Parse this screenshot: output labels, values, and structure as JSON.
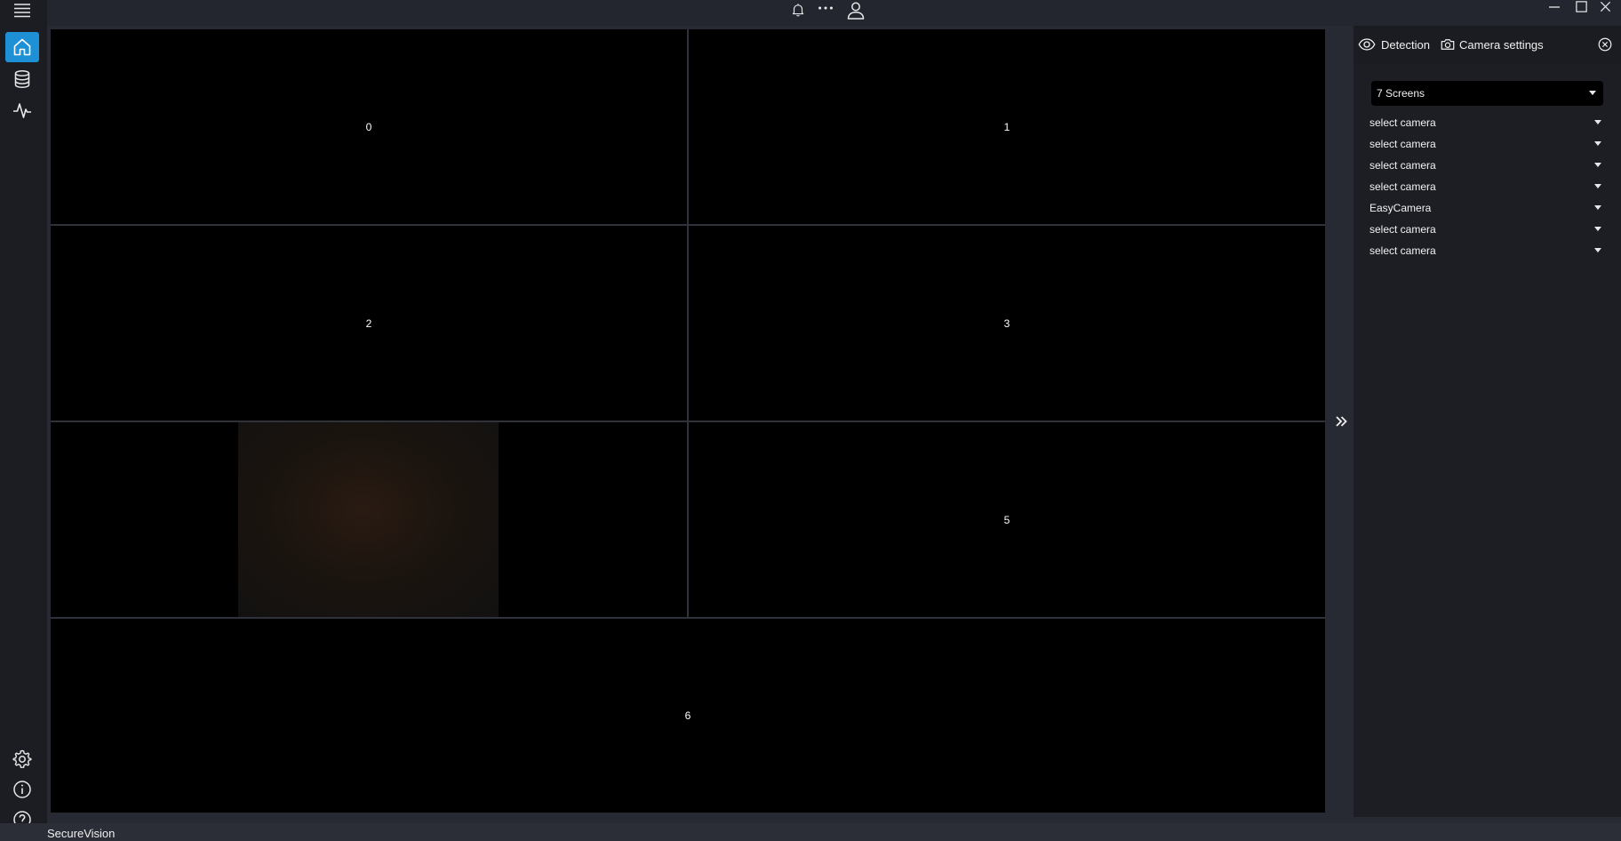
{
  "app": {
    "name": "SecureVision"
  },
  "sidebar": {
    "top_items": [
      {
        "icon": "home-icon",
        "active": true
      },
      {
        "icon": "database-icon",
        "active": false
      },
      {
        "icon": "activity-icon",
        "active": false
      }
    ],
    "bottom_items": [
      {
        "icon": "settings-icon"
      },
      {
        "icon": "info-icon"
      },
      {
        "icon": "help-icon"
      }
    ]
  },
  "titlebar": {
    "icons": [
      "bell-icon",
      "more-icon",
      "user-icon"
    ],
    "window_controls": [
      "minimize-icon",
      "maximize-icon",
      "close-icon"
    ]
  },
  "grid": {
    "cells": [
      {
        "label": "0"
      },
      {
        "label": "1"
      },
      {
        "label": "2"
      },
      {
        "label": "3"
      },
      {
        "label": ""
      },
      {
        "label": "5"
      },
      {
        "label": "6"
      }
    ]
  },
  "panel": {
    "tabs": [
      {
        "label": "Detection",
        "icon": "eye-icon"
      },
      {
        "label": "Camera settings",
        "icon": "camera-icon"
      }
    ],
    "screens_select": "7 Screens",
    "cameras": [
      "select camera",
      "select camera",
      "select camera",
      "select camera",
      "EasyCamera",
      "select camera",
      "select camera"
    ]
  },
  "colors": {
    "accent": "#1e90d6",
    "sidebar_bg": "#1b1d23",
    "panel_bg": "#1c1e24",
    "grid_bg": "#000000"
  }
}
